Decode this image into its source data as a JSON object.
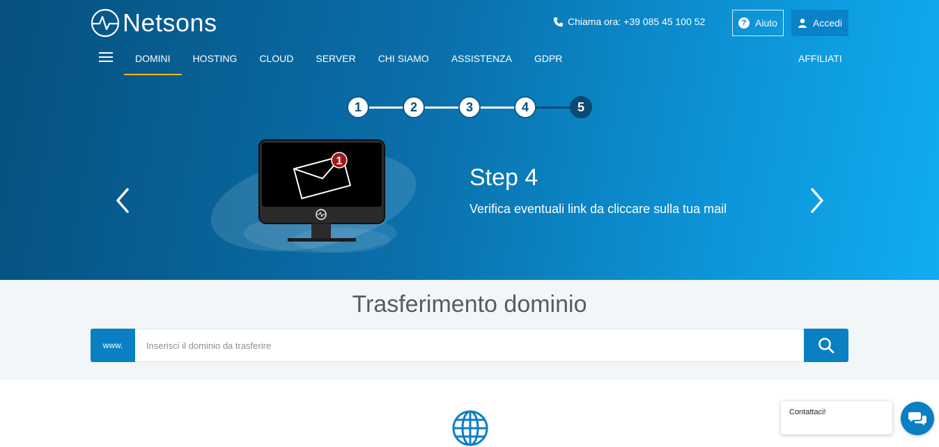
{
  "header": {
    "logo_text": "Netsons",
    "phone_text": "Chiama ora: +39 085 45 100 52",
    "help_label": "Aiuto",
    "login_label": "Accedi"
  },
  "nav": {
    "items": [
      {
        "label": "DOMINI",
        "active": true
      },
      {
        "label": "HOSTING",
        "active": false
      },
      {
        "label": "CLOUD",
        "active": false
      },
      {
        "label": "SERVER",
        "active": false
      },
      {
        "label": "CHI SIAMO",
        "active": false
      },
      {
        "label": "ASSISTENZA",
        "active": false
      },
      {
        "label": "GDPR",
        "active": false
      }
    ],
    "affiliati": "AFFILIATI"
  },
  "stepper": {
    "steps": [
      "1",
      "2",
      "3",
      "4",
      "5"
    ],
    "current": 5
  },
  "slide": {
    "title": "Step 4",
    "subtitle": "Verifica eventuali link da cliccare sulla tua mail",
    "notification_count": "1"
  },
  "search": {
    "title": "Trasferimento dominio",
    "prefix": "www.",
    "placeholder": "Inserisci il dominio da trasferire",
    "value": ""
  },
  "chat": {
    "label": "Contattaci!"
  },
  "colors": {
    "accent": "#0a7fc4",
    "nav_underline": "#f3b71d",
    "badge": "#a41616"
  }
}
